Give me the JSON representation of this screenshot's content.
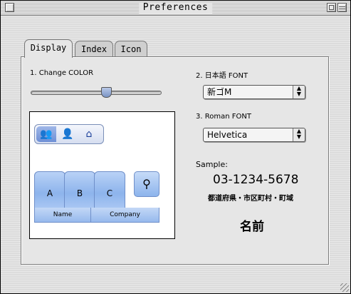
{
  "window": {
    "title": "Preferences"
  },
  "tabs": [
    {
      "label": "Display",
      "active": true
    },
    {
      "label": "Index",
      "active": false
    },
    {
      "label": "Icon",
      "active": false
    }
  ],
  "color_section": {
    "label": "1. Change COLOR",
    "slider_value": 0.58
  },
  "japanese_font": {
    "label": "2. 日本語 FONT",
    "selected": "新ゴM"
  },
  "roman_font": {
    "label": "3. Roman FONT",
    "selected": "Helvetica"
  },
  "preview": {
    "toolbar_icons": [
      "people-icon",
      "person-icon",
      "house-icon"
    ],
    "letter_tabs": [
      "A",
      "B",
      "C"
    ],
    "search_icon": "magnifier-icon",
    "columns": [
      "Name",
      "Company"
    ],
    "accent_color": "#8db4ec"
  },
  "sample": {
    "label": "Sample:",
    "phone": "03-1234-5678",
    "address": "都道府県・市区町村・町域",
    "name": "名前"
  }
}
